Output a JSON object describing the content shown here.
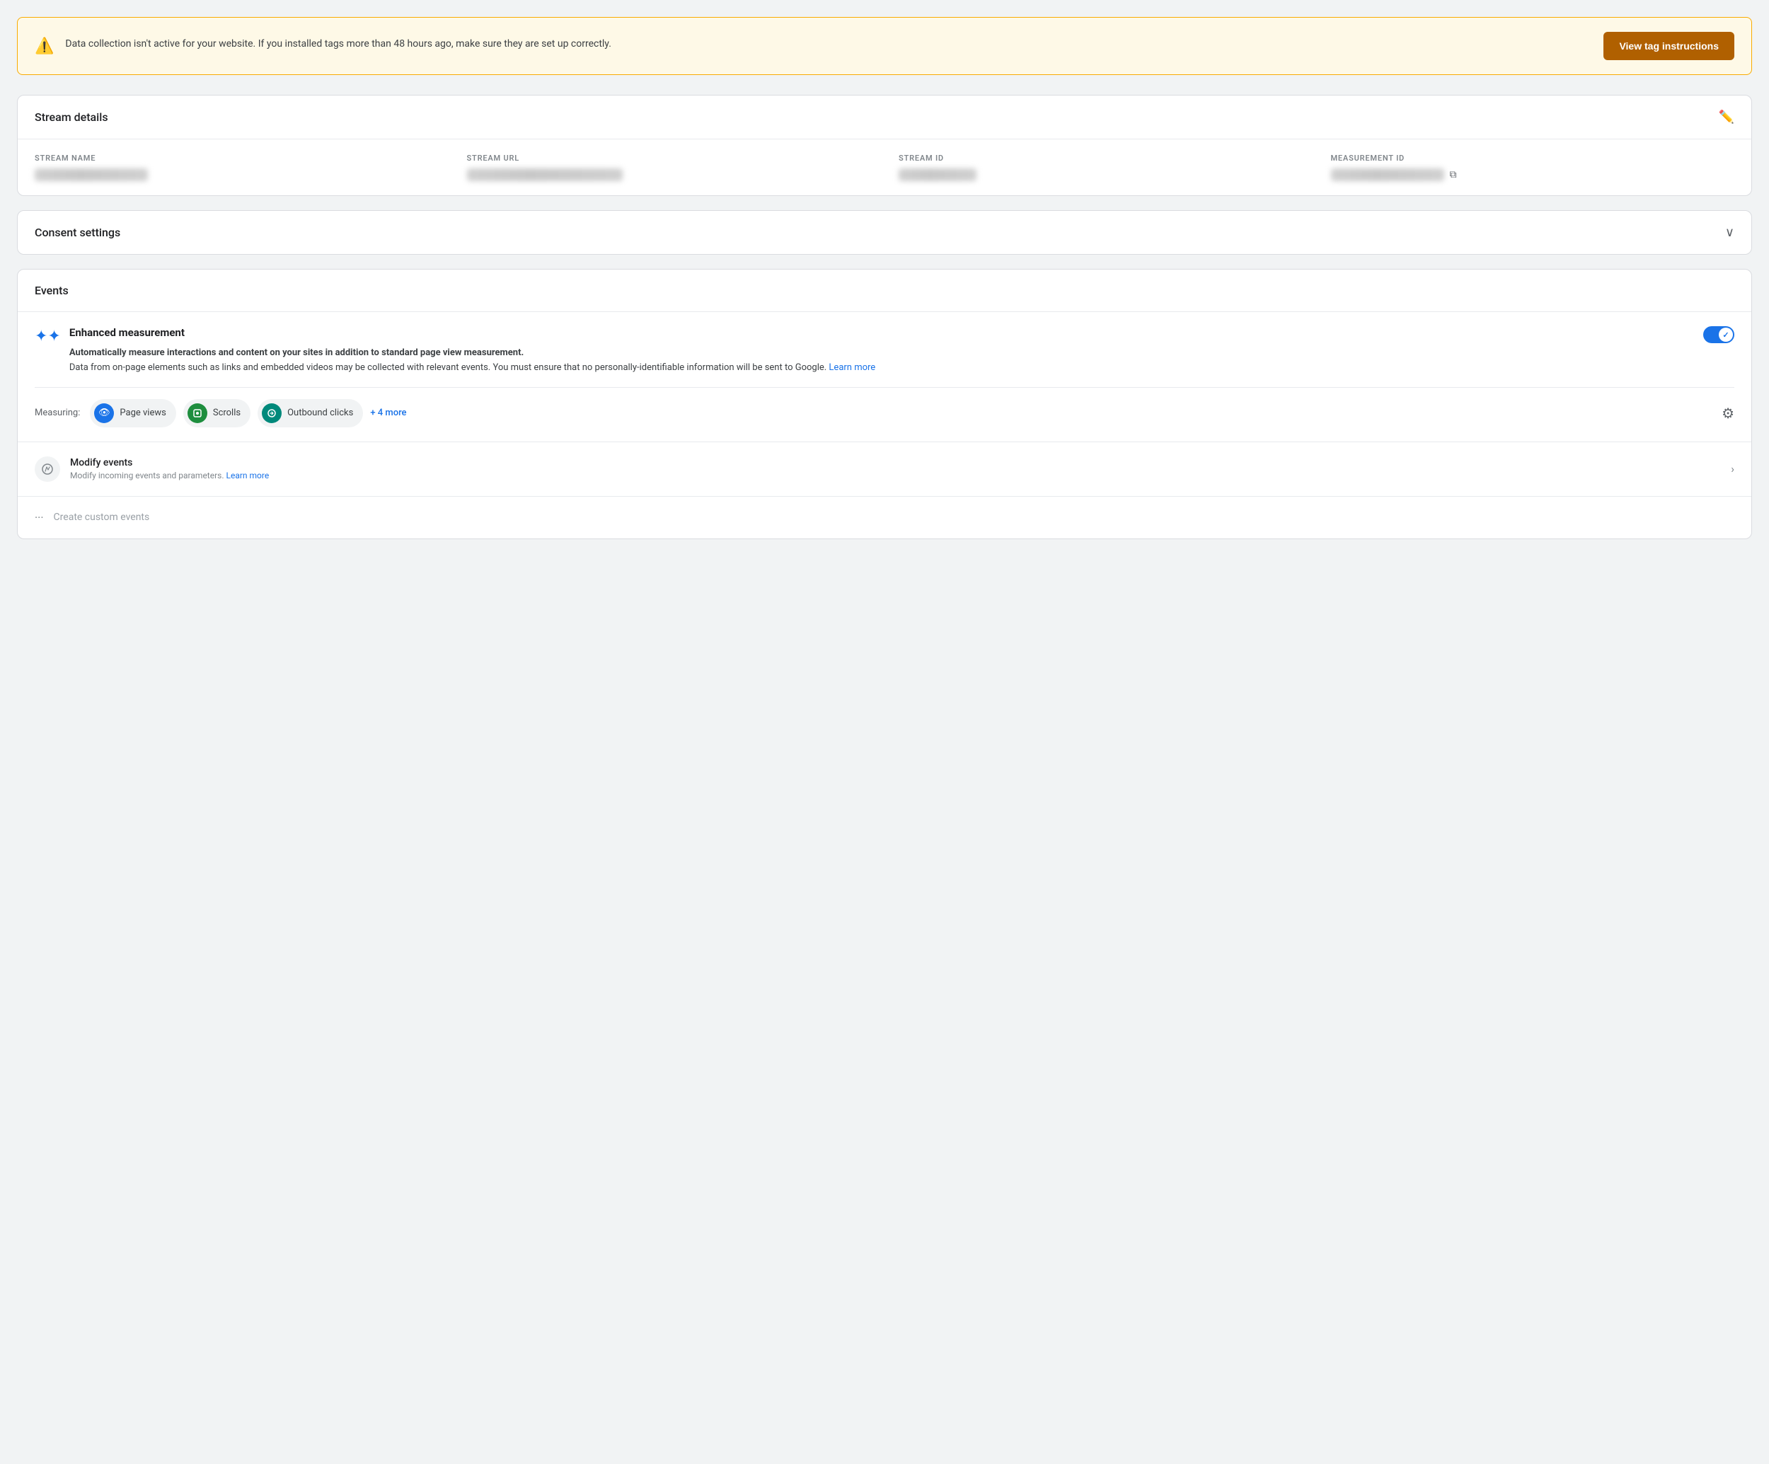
{
  "warning": {
    "text": "Data collection isn't active for your website. If you installed tags more than 48 hours ago, make sure they are set up correctly.",
    "button_label": "View tag instructions",
    "icon": "⚠"
  },
  "stream_details": {
    "title": "Stream details",
    "fields": [
      {
        "label": "STREAM NAME",
        "blurred": true,
        "size": "normal"
      },
      {
        "label": "STREAM URL",
        "blurred": true,
        "size": "wide"
      },
      {
        "label": "STREAM ID",
        "blurred": true,
        "size": "normal"
      },
      {
        "label": "MEASUREMENT ID",
        "blurred": true,
        "size": "normal",
        "has_copy": true
      }
    ]
  },
  "consent_settings": {
    "title": "Consent settings"
  },
  "events": {
    "title": "Events",
    "enhanced_measurement": {
      "title": "Enhanced measurement",
      "description": "Automatically measure interactions and content on your sites in addition to standard page view measurement.",
      "description2": "Data from on-page elements such as links and embedded videos may be collected with relevant events. You must ensure that no personally-identifiable information will be sent to Google.",
      "learn_more": "Learn more",
      "toggle_on": true
    },
    "measuring_label": "Measuring:",
    "chips": [
      {
        "label": "Page views",
        "icon": "👁",
        "color": "blue"
      },
      {
        "label": "Scrolls",
        "icon": "◈",
        "color": "green"
      },
      {
        "label": "Outbound clicks",
        "icon": "🔗",
        "color": "teal"
      }
    ],
    "more_link": "+ 4 more",
    "rows": [
      {
        "title": "Modify events",
        "subtitle": "Modify incoming events and parameters.",
        "subtitle_link": "Learn more",
        "icon": "✏"
      }
    ],
    "create_custom": {
      "label": "Create custom events",
      "icon": "···"
    }
  }
}
